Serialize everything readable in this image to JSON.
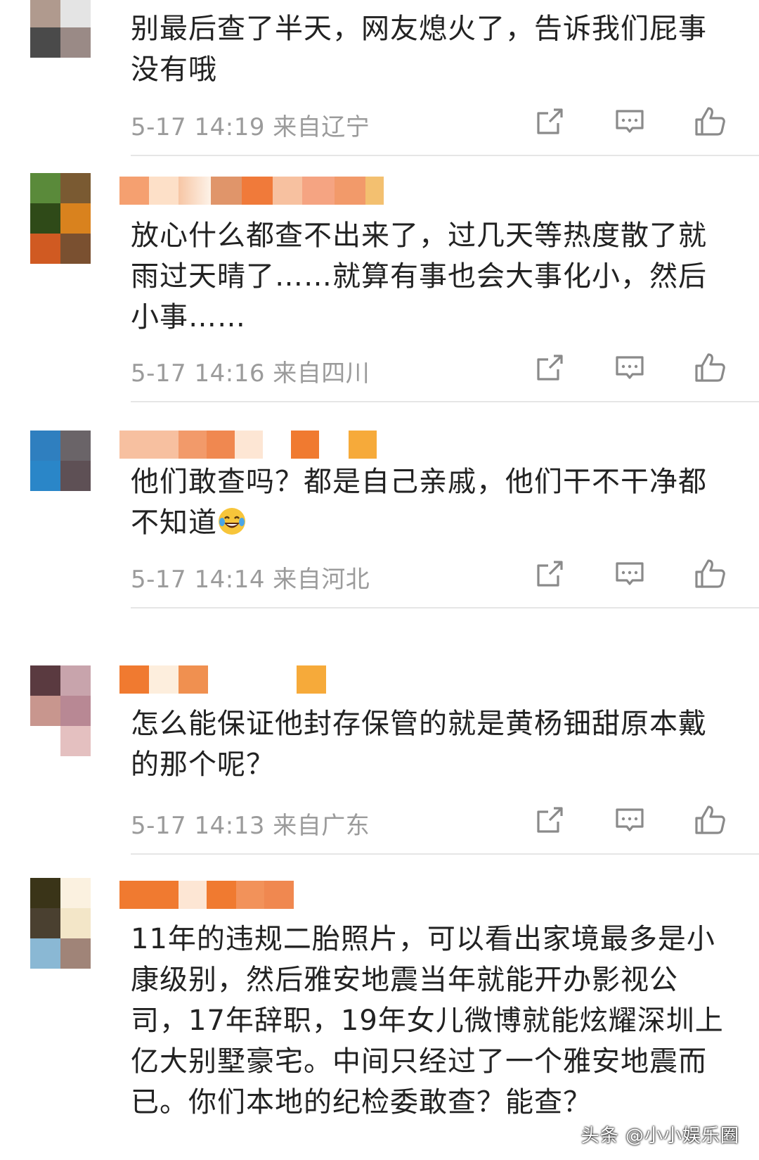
{
  "comments": [
    {
      "text": "别最后查了半天，网友熄火了，告诉我们屁事没有哦",
      "time": "5-17 14:19",
      "location": "来自辽宁"
    },
    {
      "text": "放心什么都查不出来了，过几天等热度散了就雨过天晴了……就算有事也会大事化小，然后小事……",
      "time": "5-17 14:16",
      "location": "来自四川"
    },
    {
      "text": "他们敢查吗？都是自己亲戚，他们干不干净都不知道",
      "time": "5-17 14:14",
      "location": "来自河北"
    },
    {
      "text": "怎么能保证他封存保管的就是黄杨钿甜原本戴的那个呢？",
      "time": "5-17 14:13",
      "location": "来自广东"
    },
    {
      "text": "11年的违规二胎照片，可以看出家境最多是小康级别，然后雅安地震当年就能开办影视公司，17年辞职，19年女儿微博就能炫耀深圳上亿大别墅豪宅。中间只经过了一个雅安地震而已。你们本地的纪检委敢查？能查？"
    }
  ],
  "watermark": "头条 @小小娱乐圈",
  "icons": {
    "share": "share-icon",
    "comment": "comment-icon",
    "like": "thumbs-up-icon",
    "emoji": "laughing-tears-emoji"
  },
  "colors": {
    "text": "#222222",
    "meta": "#9b9b9b",
    "icon": "#8a8a8a",
    "divider": "#e6e6e6"
  }
}
